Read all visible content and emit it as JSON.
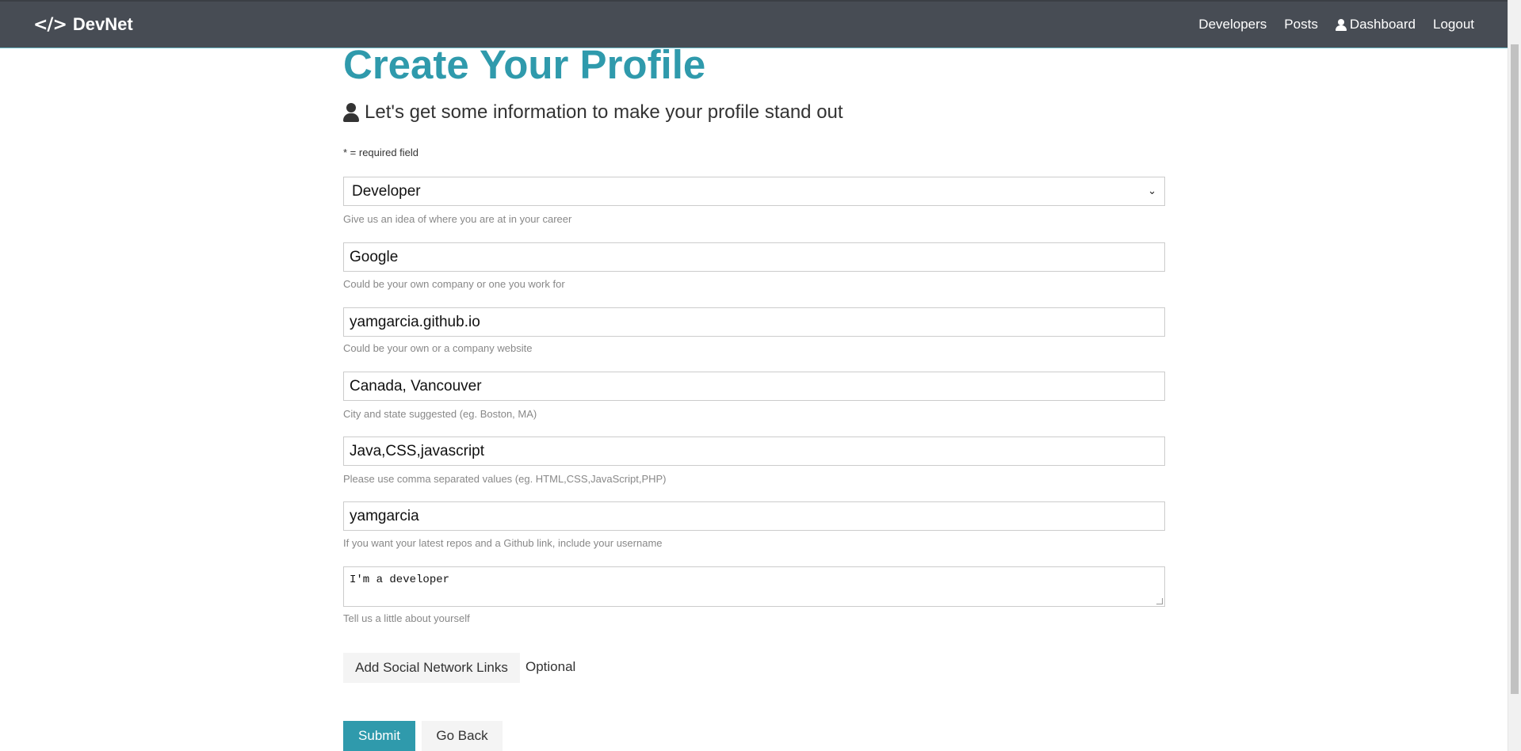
{
  "navbar": {
    "brand_icon": "</>",
    "brand": "DevNet",
    "links": {
      "developers": "Developers",
      "posts": "Posts",
      "dashboard": "Dashboard",
      "logout": "Logout"
    }
  },
  "header": {
    "title": "Create Your Profile",
    "lead": "Let's get some information to make your profile stand out",
    "required_note": "* = required field"
  },
  "form": {
    "status": {
      "value": "Developer",
      "hint": "Give us an idea of where you are at in your career"
    },
    "company": {
      "value": "Google",
      "hint": "Could be your own company or one you work for"
    },
    "website": {
      "value": "yamgarcia.github.io",
      "hint": "Could be your own or a company website"
    },
    "location": {
      "value": "Canada, Vancouver",
      "hint": "City and state suggested (eg. Boston, MA)"
    },
    "skills": {
      "value": "Java,CSS,javascript",
      "hint": "Please use comma separated values (eg. HTML,CSS,JavaScript,PHP)"
    },
    "github": {
      "value": "yamgarcia",
      "hint": "If you want your latest repos and a Github link, include your username"
    },
    "bio": {
      "value": "I'm a developer",
      "hint": "Tell us a little about yourself"
    }
  },
  "social": {
    "button": "Add Social Network Links",
    "optional": "Optional"
  },
  "actions": {
    "submit": "Submit",
    "back": "Go Back"
  },
  "colors": {
    "primary": "#2f9aac",
    "navbar": "#474c54"
  }
}
